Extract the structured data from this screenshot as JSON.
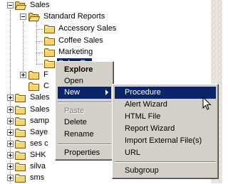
{
  "tree": {
    "sales": "Sales",
    "standard_reports": "Standard Reports",
    "accessory_sales": "Accessory Sales",
    "coffee_sales": "Coffee Sales",
    "marketing": "Marketing",
    "selected_partial": "Sales Re",
    "partial_f": "F",
    "partial_c": "C",
    "siblings": [
      "Sales",
      "Sales",
      "samp",
      "Saye",
      "ses c",
      "SHK",
      "silva",
      "sms"
    ]
  },
  "context_menu": {
    "explore": "Explore",
    "open": "Open",
    "new": "New",
    "paste": "Paste",
    "delete": "Delete",
    "rename": "Rename",
    "properties": "Properties"
  },
  "submenu": {
    "procedure": "Procedure",
    "alert_wizard": "Alert Wizard",
    "html_file": "HTML File",
    "report_wizard": "Report Wizard",
    "import_external": "Import External File(s)",
    "url": "URL",
    "subgroup": "Subgroup"
  },
  "colors": {
    "selection": "#0a246a",
    "menu_bg": "#d4d0c8",
    "folder": "#f6d36b"
  }
}
